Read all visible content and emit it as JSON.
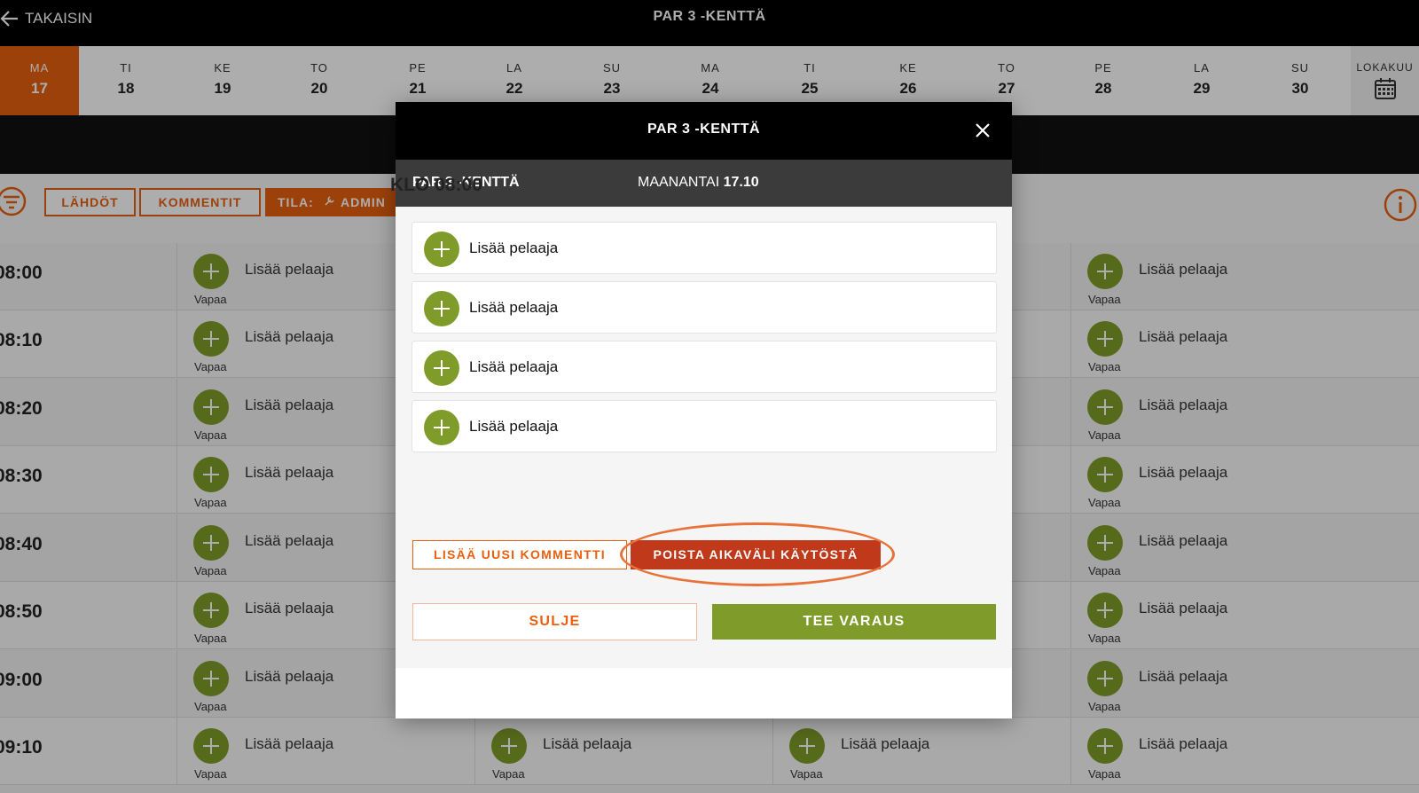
{
  "header": {
    "back_label": "TAKAISIN",
    "title": "PAR 3 -KENTTÄ"
  },
  "dates": [
    {
      "dow": "MA",
      "num": "17"
    },
    {
      "dow": "TI",
      "num": "18"
    },
    {
      "dow": "KE",
      "num": "19"
    },
    {
      "dow": "TO",
      "num": "20"
    },
    {
      "dow": "PE",
      "num": "21"
    },
    {
      "dow": "LA",
      "num": "22"
    },
    {
      "dow": "SU",
      "num": "23"
    },
    {
      "dow": "MA",
      "num": "24"
    },
    {
      "dow": "TI",
      "num": "25"
    },
    {
      "dow": "KE",
      "num": "26"
    },
    {
      "dow": "TO",
      "num": "27"
    },
    {
      "dow": "PE",
      "num": "28"
    },
    {
      "dow": "LA",
      "num": "29"
    },
    {
      "dow": "SU",
      "num": "30"
    }
  ],
  "month_label": "LOKAKUU",
  "toolbar": {
    "departures": "LÄHDÖT",
    "comments": "KOMMENTIT",
    "mode_prefix": "TILA:",
    "mode_value": "ADMIN"
  },
  "schedule": {
    "times": [
      "08:00",
      "08:10",
      "08:20",
      "08:30",
      "08:40",
      "08:50",
      "09:00",
      "09:10"
    ],
    "slot_label": "Lisää pelaaja",
    "free_label": "Vapaa"
  },
  "modal": {
    "title": "PAR 3 -KENTTÄ",
    "course": "PAR 3 -KENTTÄ",
    "day_label": "MAANANTAI",
    "date": "17.10",
    "time_label": "KLO",
    "time": "08:00",
    "players": [
      "Lisää pelaaja",
      "Lisää pelaaja",
      "Lisää pelaaja",
      "Lisää pelaaja"
    ],
    "add_comment": "LISÄÄ UUSI KOMMENTTI",
    "disable_slot": "POISTA AIKAVÄLI KÄYTÖSTÄ",
    "close": "SULJE",
    "reserve": "TEE VARAUS"
  },
  "colors": {
    "accent": "#e8600f",
    "green": "#7f9c2a",
    "danger": "#c0391b"
  },
  "icons": [
    "back-arrow-icon",
    "calendar-icon",
    "filter-icon",
    "wrench-icon",
    "info-icon",
    "close-icon",
    "plus-icon"
  ]
}
